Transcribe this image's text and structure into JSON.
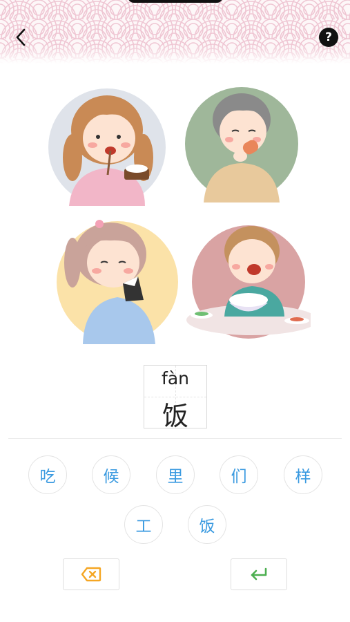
{
  "header": {
    "back_icon": "chevron-left-icon",
    "help_icon": "question-circle-icon",
    "help_glyph": "?",
    "pattern_color": "#efc6d3"
  },
  "question": {
    "pinyin": "fàn",
    "character": "饭"
  },
  "options": [
    {
      "label": "吃"
    },
    {
      "label": "候"
    },
    {
      "label": "里"
    },
    {
      "label": "们"
    },
    {
      "label": "样"
    },
    {
      "label": "工"
    },
    {
      "label": "饭"
    }
  ],
  "actions": {
    "delete_icon": "backspace-icon",
    "delete_color": "#f5a623",
    "submit_icon": "enter-return-icon",
    "submit_color": "#4caf50"
  },
  "colors": {
    "option_text": "#3a9ae0"
  }
}
